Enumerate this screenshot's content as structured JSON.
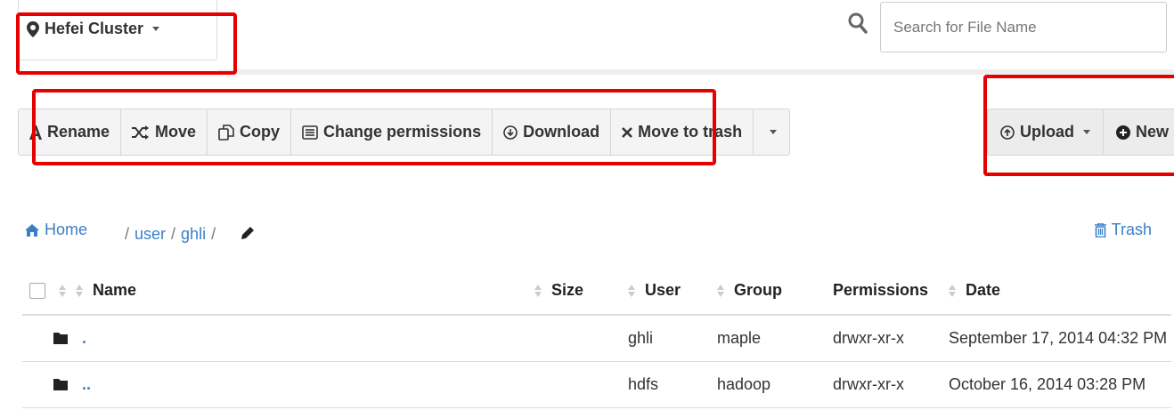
{
  "cluster": {
    "label": "Hefei Cluster"
  },
  "search": {
    "placeholder": "Search for File Name"
  },
  "toolbar": {
    "rename": "Rename",
    "move": "Move",
    "copy": "Copy",
    "change_permissions": "Change permissions",
    "download": "Download",
    "move_to_trash": "Move to trash"
  },
  "actions": {
    "upload": "Upload",
    "new": "New"
  },
  "breadcrumb": {
    "home": "Home",
    "path": [
      "user",
      "ghli"
    ]
  },
  "trash": {
    "label": "Trash"
  },
  "table": {
    "headers": {
      "name": "Name",
      "size": "Size",
      "user": "User",
      "group": "Group",
      "permissions": "Permissions",
      "date": "Date"
    },
    "rows": [
      {
        "name": ".",
        "size": "",
        "user": "ghli",
        "group": "maple",
        "permissions": "drwxr-xr-x",
        "date": "September 17, 2014 04:32 PM"
      },
      {
        "name": "..",
        "size": "",
        "user": "hdfs",
        "group": "hadoop",
        "permissions": "drwxr-xr-x",
        "date": "October 16, 2014 03:28 PM"
      }
    ]
  },
  "colors": {
    "link": "#3a7fc6",
    "highlight": "#e60000",
    "toolbar_bg": "#f4f4f4"
  },
  "icons": [
    "map-marker-icon",
    "search-icon",
    "font-icon",
    "shuffle-icon",
    "copy-icon",
    "list-icon",
    "download-icon",
    "times-icon",
    "upload-icon",
    "plus-circle-icon",
    "home-icon",
    "pencil-icon",
    "trash-icon",
    "folder-icon",
    "sort-icon"
  ]
}
